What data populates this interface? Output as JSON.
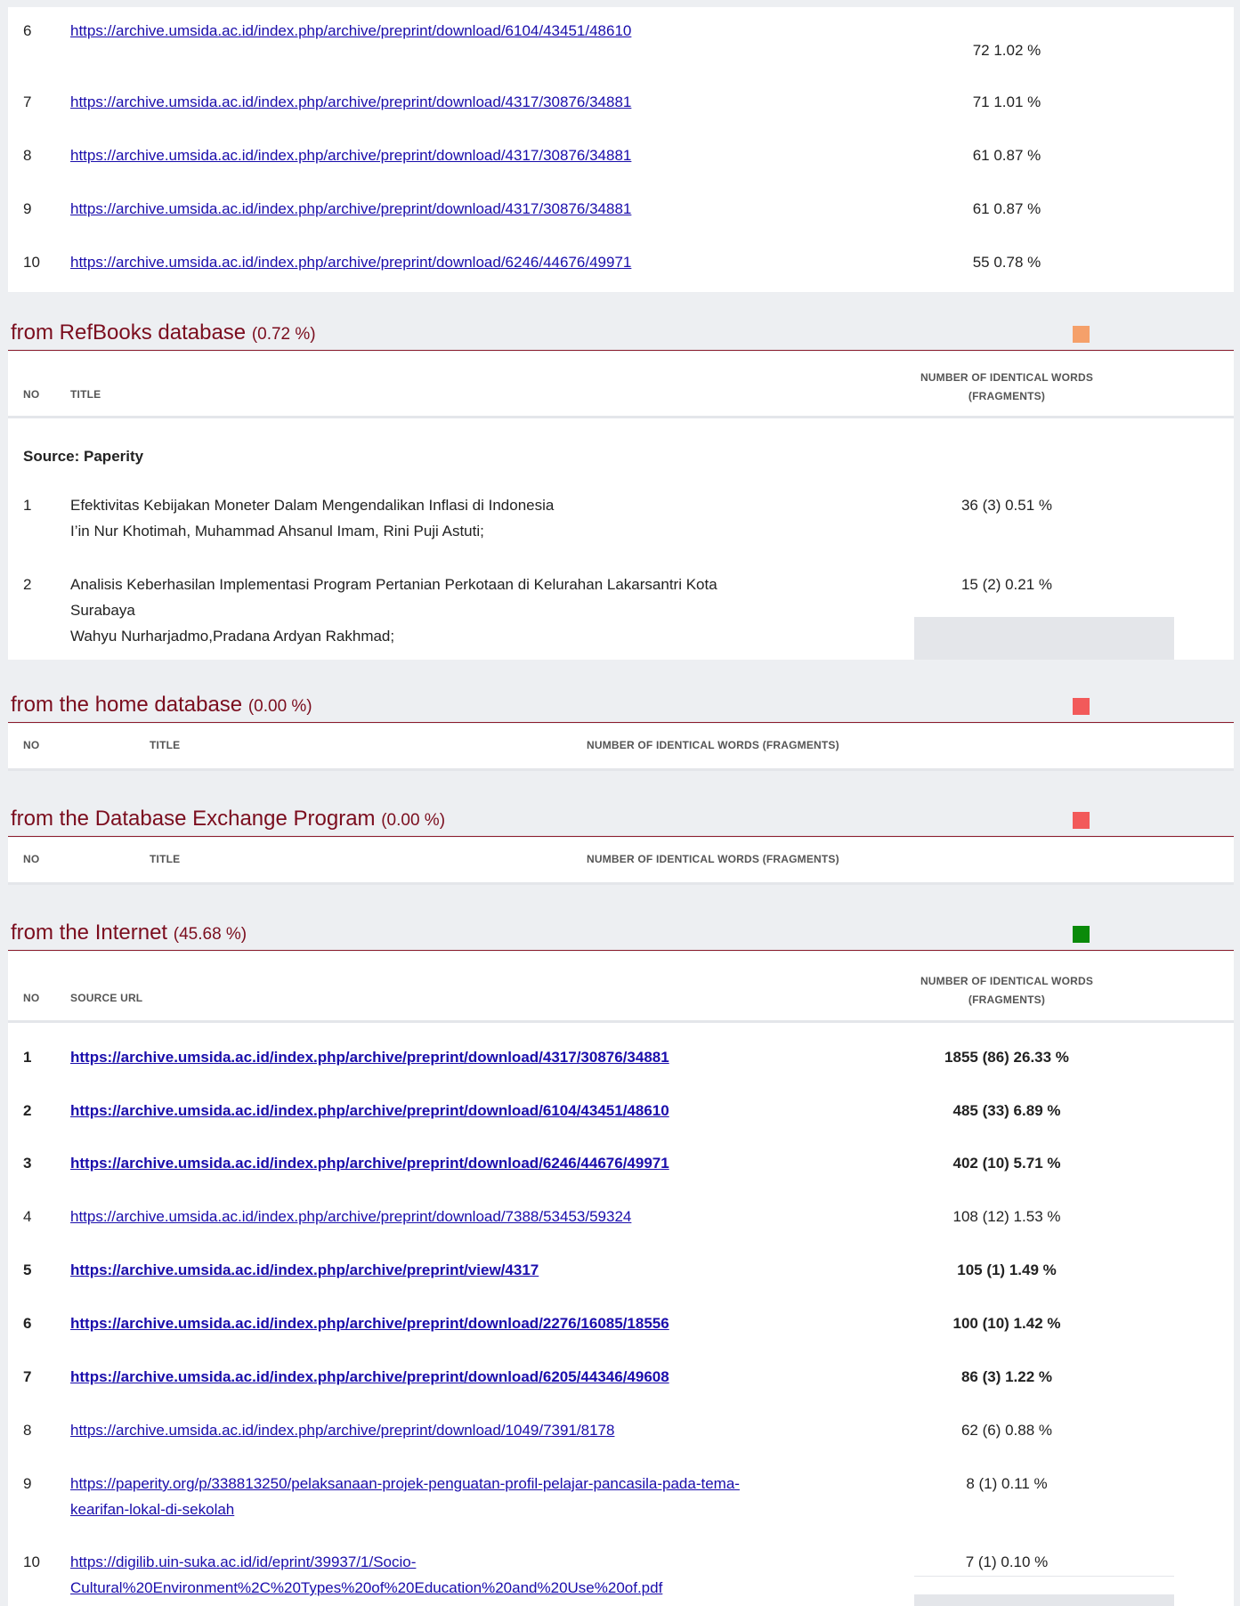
{
  "top_rows": [
    {
      "no": "6",
      "url": "https://archive.umsida.ac.id/index.php/archive/preprint/download/6104/43451/48610",
      "count": "72  1.02 %"
    },
    {
      "no": "7",
      "url": "https://archive.umsida.ac.id/index.php/archive/preprint/download/4317/30876/34881",
      "count": "71  1.01 %"
    },
    {
      "no": "8",
      "url": "https://archive.umsida.ac.id/index.php/archive/preprint/download/4317/30876/34881",
      "count": "61  0.87 %"
    },
    {
      "no": "9",
      "url": "https://archive.umsida.ac.id/index.php/archive/preprint/download/4317/30876/34881",
      "count": "61  0.87 %"
    },
    {
      "no": "10",
      "url": "https://archive.umsida.ac.id/index.php/archive/preprint/download/6246/44676/49971",
      "count": "55  0.78 %"
    }
  ],
  "refbooks": {
    "title": "from RefBooks database",
    "pct": "(0.72 %)",
    "color": "#f5a06a",
    "col_no": "NO",
    "col_title": "TITLE",
    "col_count_1": "NUMBER OF IDENTICAL WORDS",
    "col_count_2": "(FRAGMENTS)",
    "source": "Source: Paperity",
    "items": [
      {
        "no": "1",
        "title": "Efektivitas Kebijakan Moneter Dalam Mengendalikan Inflasi di Indonesia",
        "title2": "",
        "authors": "I’in Nur Khotimah, Muhammad Ahsanul Imam, Rini Puji Astuti;",
        "count": "36 (3)  0.51 %"
      },
      {
        "no": "2",
        "title": "Analisis Keberhasilan Implementasi Program Pertanian Perkotaan di Kelurahan Lakarsantri Kota",
        "title2": "Surabaya",
        "authors": "Wahyu Nurharjadmo,Pradana Ardyan Rakhmad;",
        "count": "15 (2)  0.21 %"
      }
    ]
  },
  "home": {
    "title": "from the home database",
    "pct": "(0.00 %)",
    "color": "#f25a5a",
    "col_no": "NO",
    "col_title": "TITLE",
    "col_count": "NUMBER OF IDENTICAL WORDS (FRAGMENTS)"
  },
  "exchange": {
    "title": "from the Database Exchange Program",
    "pct": "(0.00 %)",
    "color": "#f25a5a",
    "col_no": "NO",
    "col_title": "TITLE",
    "col_count": "NUMBER OF IDENTICAL WORDS (FRAGMENTS)"
  },
  "internet": {
    "title": "from the Internet",
    "pct": "(45.68 %)",
    "color": "#0a8a0a",
    "col_no": "NO",
    "col_url": "SOURCE URL",
    "col_count_1": "NUMBER OF IDENTICAL WORDS",
    "col_count_2": "(FRAGMENTS)",
    "rows": [
      {
        "no": "1",
        "url": "https://archive.umsida.ac.id/index.php/archive/preprint/download/4317/30876/34881",
        "url2": "",
        "count": "1855 (86)  26.33 %",
        "bold": true
      },
      {
        "no": "2",
        "url": "https://archive.umsida.ac.id/index.php/archive/preprint/download/6104/43451/48610",
        "url2": "",
        "count": "485 (33)  6.89 %",
        "bold": true
      },
      {
        "no": "3",
        "url": "https://archive.umsida.ac.id/index.php/archive/preprint/download/6246/44676/49971",
        "url2": "",
        "count": "402 (10)  5.71 %",
        "bold": true
      },
      {
        "no": "4",
        "url": "https://archive.umsida.ac.id/index.php/archive/preprint/download/7388/53453/59324",
        "url2": "",
        "count": "108 (12)  1.53 %",
        "bold": false
      },
      {
        "no": "5",
        "url": "https://archive.umsida.ac.id/index.php/archive/preprint/view/4317",
        "url2": "",
        "count": "105 (1)  1.49 %",
        "bold": true
      },
      {
        "no": "6",
        "url": "https://archive.umsida.ac.id/index.php/archive/preprint/download/2276/16085/18556",
        "url2": "",
        "count": "100 (10)  1.42 %",
        "bold": true
      },
      {
        "no": "7",
        "url": "https://archive.umsida.ac.id/index.php/archive/preprint/download/6205/44346/49608",
        "url2": "",
        "count": "86 (3)  1.22 %",
        "bold": true
      },
      {
        "no": "8",
        "url": "https://archive.umsida.ac.id/index.php/archive/preprint/download/1049/7391/8178",
        "url2": "",
        "count": "62 (6)  0.88 %",
        "bold": false
      },
      {
        "no": "9",
        "url": "https://paperity.org/p/338813250/pelaksanaan-projek-penguatan-profil-pelajar-pancasila-pada-tema-",
        "url2": "kearifan-lokal-di-sekolah",
        "count": "8 (1)  0.11 %",
        "bold": false
      },
      {
        "no": "10",
        "url": "https://digilib.uin-suka.ac.id/id/eprint/39937/1/Socio-",
        "url2": "Cultural%20Environment%2C%20Types%20of%20Education%20and%20Use%20of.pdf",
        "count": "7 (1)  0.10 %",
        "bold": false
      }
    ]
  }
}
